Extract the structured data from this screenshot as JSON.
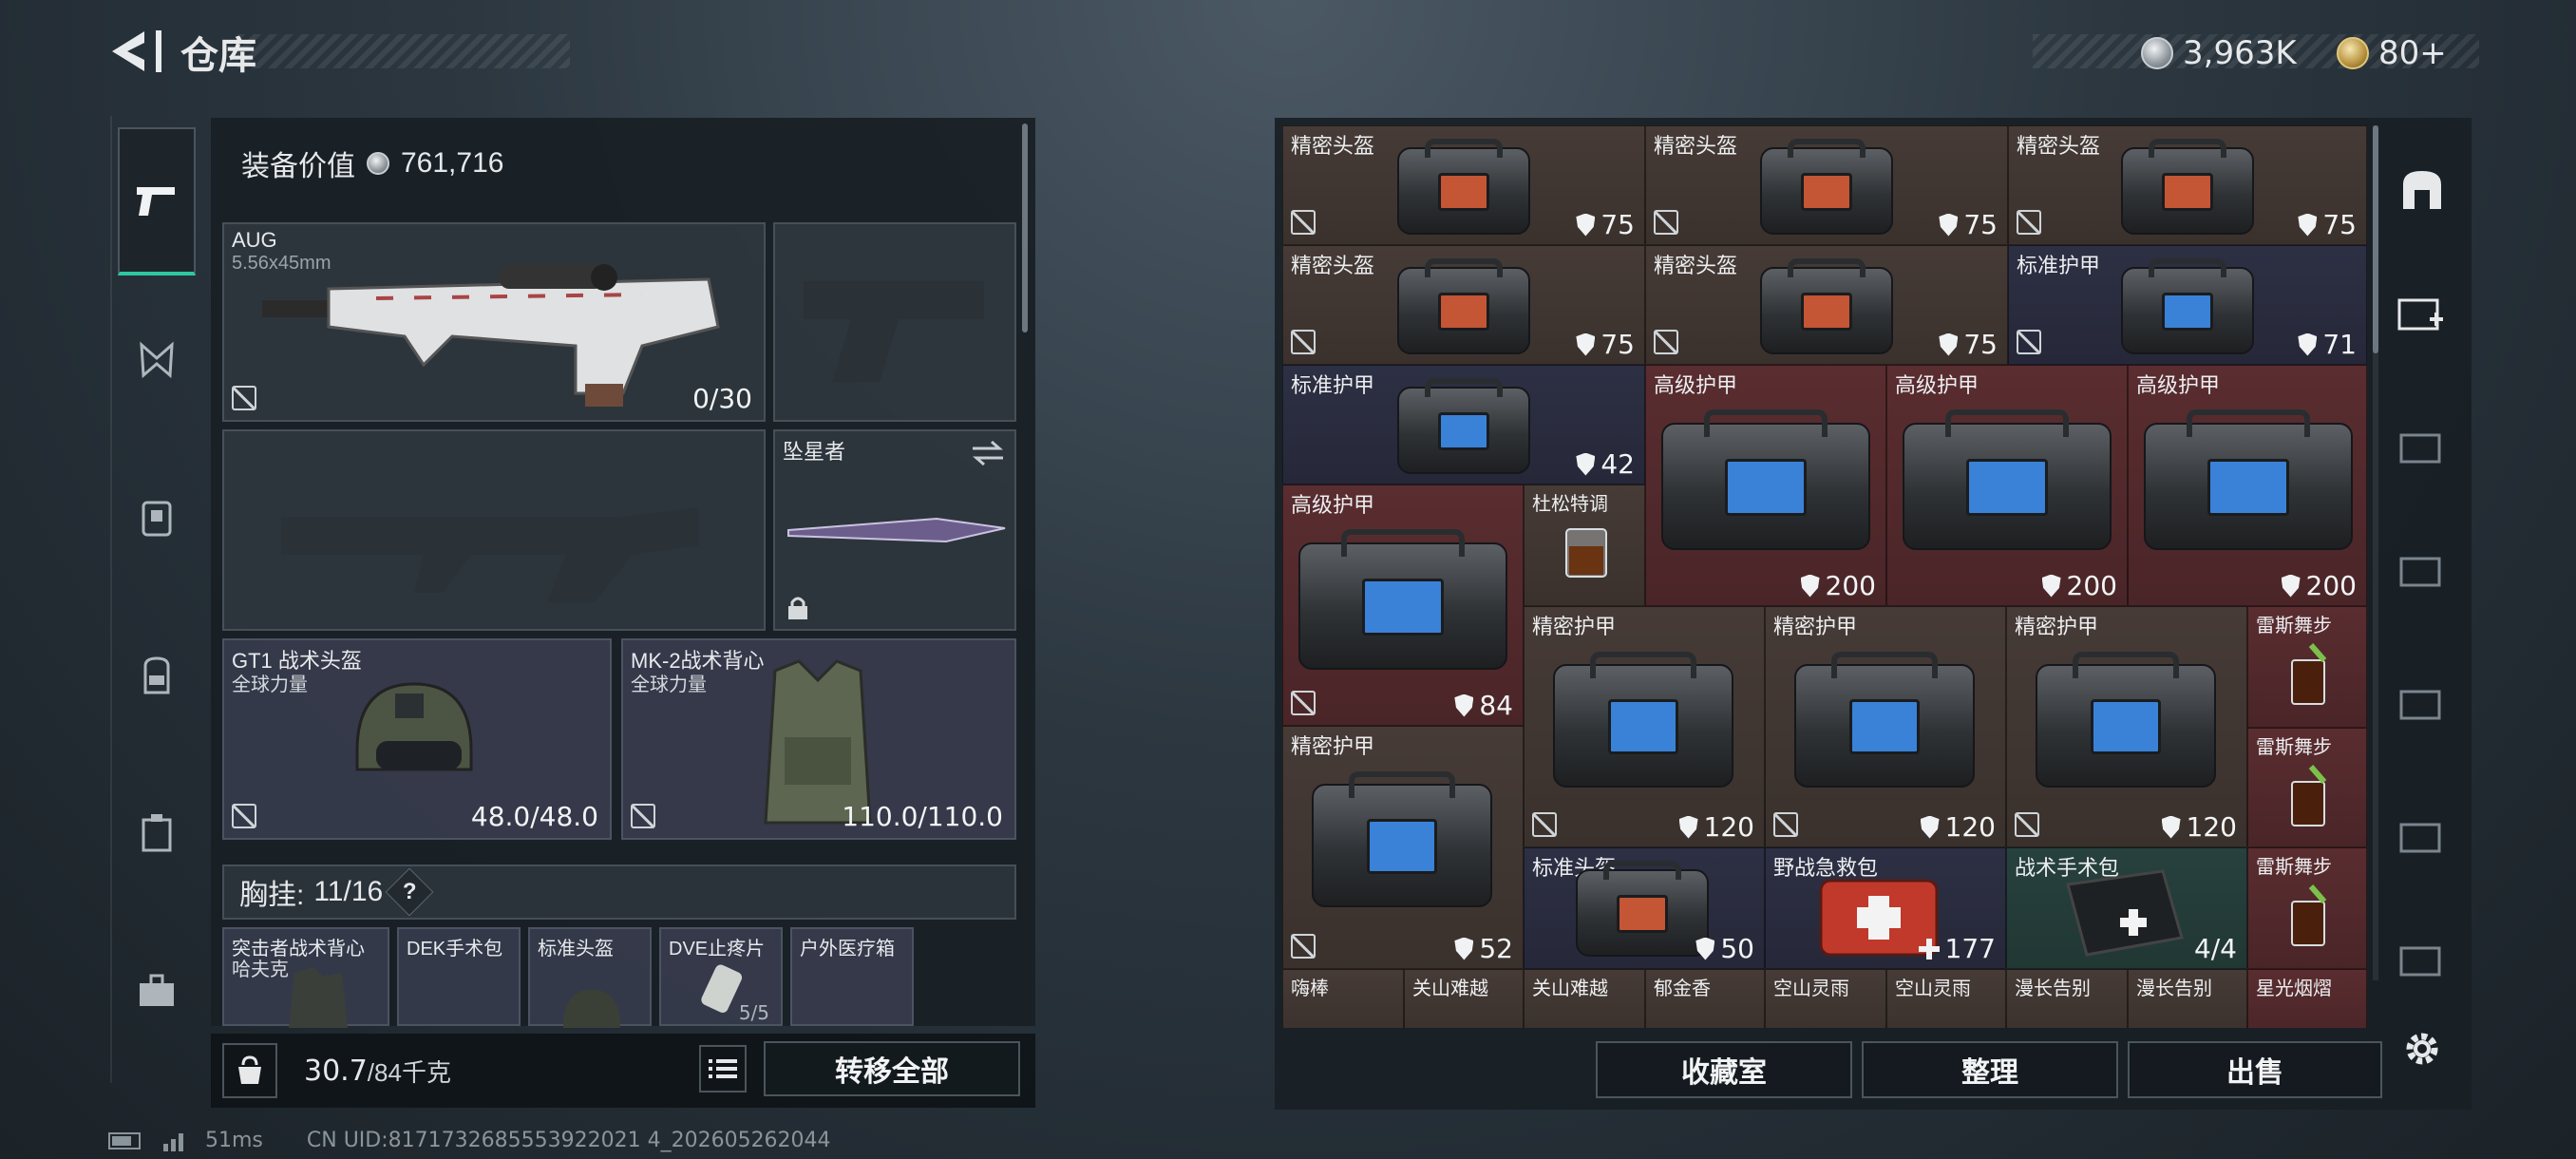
{
  "header": {
    "title": "仓库",
    "currency_silver": "3,963K",
    "currency_gold": "80+"
  },
  "loadout": {
    "value_label": "装备价值",
    "value": "761,716",
    "primary": {
      "name": "AUG",
      "caliber": "5.56x45mm",
      "ammo": "0/30"
    },
    "melee": {
      "name": "坠星者"
    },
    "helmet": {
      "name": "GT1 战术头盔",
      "brand": "全球力量",
      "durability": "48.0/48.0"
    },
    "armor": {
      "name": "MK-2战术背心",
      "brand": "全球力量",
      "durability": "110.0/110.0"
    },
    "rig": {
      "label": "胸挂:",
      "count": "11/16",
      "help": "?"
    },
    "rig_items": [
      {
        "name": "突击者战术背心",
        "sub": "哈夫克"
      },
      {
        "name": "DEK手术包"
      },
      {
        "name": "标准头盔"
      },
      {
        "name": "DVE止疼片",
        "val": "5/5"
      },
      {
        "name": "户外医疗箱"
      }
    ],
    "weight": "30.7",
    "weight_cap": "/84千克",
    "transfer_all": "转移全部"
  },
  "stash": {
    "items": [
      {
        "name": "精密头盔",
        "val": "75"
      },
      {
        "name": "精密头盔",
        "val": "75"
      },
      {
        "name": "精密头盔",
        "val": "75"
      },
      {
        "name": "精密头盔",
        "val": "75"
      },
      {
        "name": "精密头盔",
        "val": "75"
      },
      {
        "name": "标准护甲",
        "val": "71"
      },
      {
        "name": "标准护甲",
        "val": "42"
      },
      {
        "name": "高级护甲",
        "val": "200"
      },
      {
        "name": "高级护甲",
        "val": "200"
      },
      {
        "name": "高级护甲",
        "val": "200"
      },
      {
        "name": "高级护甲",
        "val": "84"
      },
      {
        "name": "杜松特调",
        "val": ""
      },
      {
        "name": "精密护甲",
        "val": "120"
      },
      {
        "name": "精密护甲",
        "val": "120"
      },
      {
        "name": "精密护甲",
        "val": "120"
      },
      {
        "name": "雷斯舞步",
        "val": ""
      },
      {
        "name": "精密护甲",
        "val": "52"
      },
      {
        "name": "雷斯舞步",
        "val": ""
      },
      {
        "name": "标准头盔",
        "val": "50"
      },
      {
        "name": "野战急救包",
        "val": "177"
      },
      {
        "name": "战术手术包",
        "val": "4/4"
      },
      {
        "name": "雷斯舞步",
        "val": ""
      }
    ],
    "bottom_row": [
      "嗨棒",
      "关山难越",
      "关山难越",
      "郁金香",
      "空山灵雨",
      "空山灵雨",
      "漫长告别",
      "漫长告别",
      "星光烟熠"
    ],
    "btn_collect": "收藏室",
    "btn_sort": "整理",
    "btn_sell": "出售"
  },
  "status": {
    "ping": "51ms",
    "uid": "CN UID:8171732685553922021 4_202605262044"
  },
  "colors": {
    "accent": "#2ec7a3",
    "red_cell": "#5a2d30",
    "brown_cell": "#463b36",
    "blue_cell": "#2d3044"
  }
}
